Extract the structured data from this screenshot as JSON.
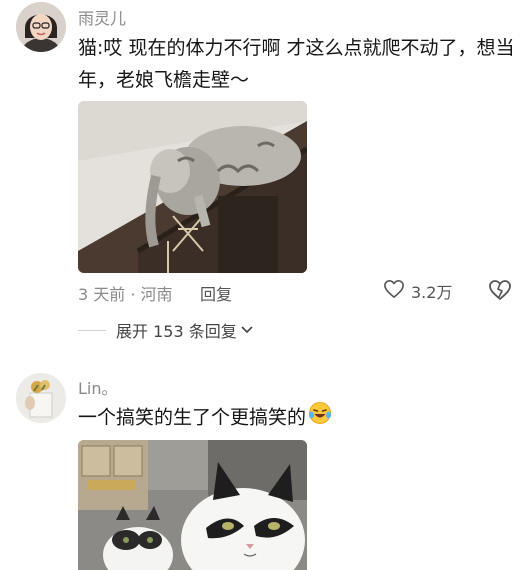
{
  "comments": [
    {
      "username": "雨灵儿",
      "text": "猫:哎  现在的体力不行啊   才这么点就爬不动了，想当年，老娘飞檐走壁～",
      "meta": "3 天前 · 河南",
      "reply_label": "回复",
      "likes": "3.2万",
      "expand_label": "展开 153 条回复"
    },
    {
      "username": "Lin。",
      "text": "一个搞笑的生了个更搞笑的",
      "emoji": "laughing-crying-emoji"
    }
  ],
  "icons": {
    "like": "heart-icon",
    "dislike": "broken-heart-icon",
    "expand": "chevron-down-icon"
  }
}
